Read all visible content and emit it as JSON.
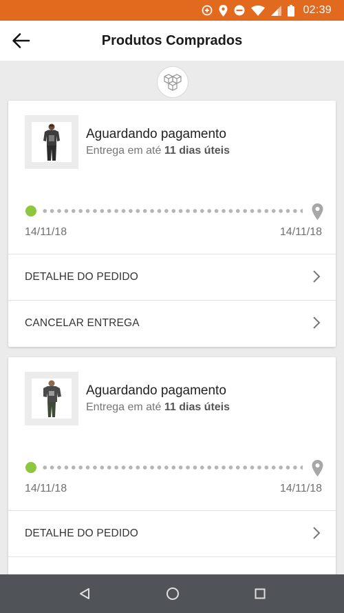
{
  "status_bar": {
    "time": "02:39",
    "icons": [
      "data-saver-icon",
      "location-icon",
      "do-not-disturb-icon",
      "wifi-icon",
      "signal-icon",
      "battery-icon"
    ],
    "color": "#e26a1f"
  },
  "header": {
    "title": "Produtos Comprados"
  },
  "orders": [
    {
      "status": "Aguardando pagamento",
      "delivery_prefix": "Entrega em até",
      "delivery_days": "11 dias úteis",
      "date_start": "14/11/18",
      "date_end": "14/11/18",
      "actions": [
        "DETALHE DO PEDIDO",
        "CANCELAR ENTREGA"
      ]
    },
    {
      "status": "Aguardando pagamento",
      "delivery_prefix": "Entrega em até",
      "delivery_days": "11 dias úteis",
      "date_start": "14/11/18",
      "date_end": "14/11/18",
      "actions": [
        "DETALHE DO PEDIDO"
      ]
    }
  ],
  "colors": {
    "progress_start": "#8dc63f",
    "nav_bar": "#505459"
  }
}
